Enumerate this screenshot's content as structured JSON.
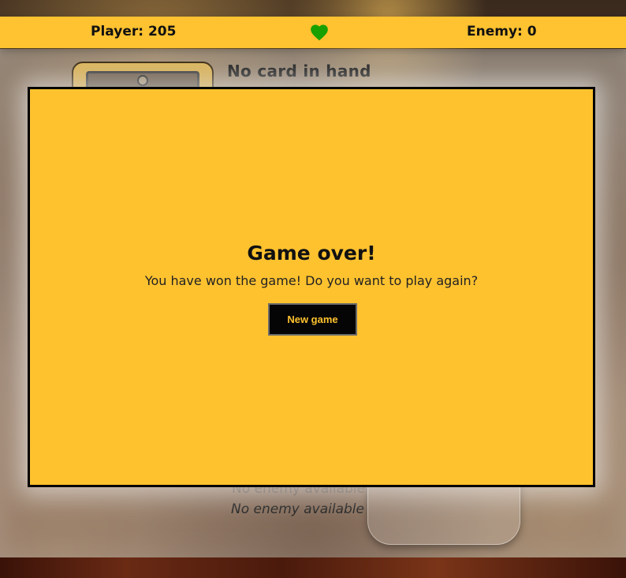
{
  "scorebar": {
    "player_score": "Player: 205",
    "enemy_score": "Enemy: 0",
    "heart_icon": "heart-icon",
    "heart_color": "#17a000",
    "bar_color": "#ffc230"
  },
  "player_area": {
    "deck_icon": "card-deck-icon",
    "hand_status": "No card in hand"
  },
  "enemy_area": {
    "status_ghost": "No enemy available",
    "status": "No enemy available"
  },
  "modal": {
    "title": "Game over!",
    "message": "You have won the game! Do you want to play again?",
    "button_label": "New game",
    "background": "#ffc22f",
    "button_background": "#050505",
    "button_text_color": "#ffc22f"
  }
}
